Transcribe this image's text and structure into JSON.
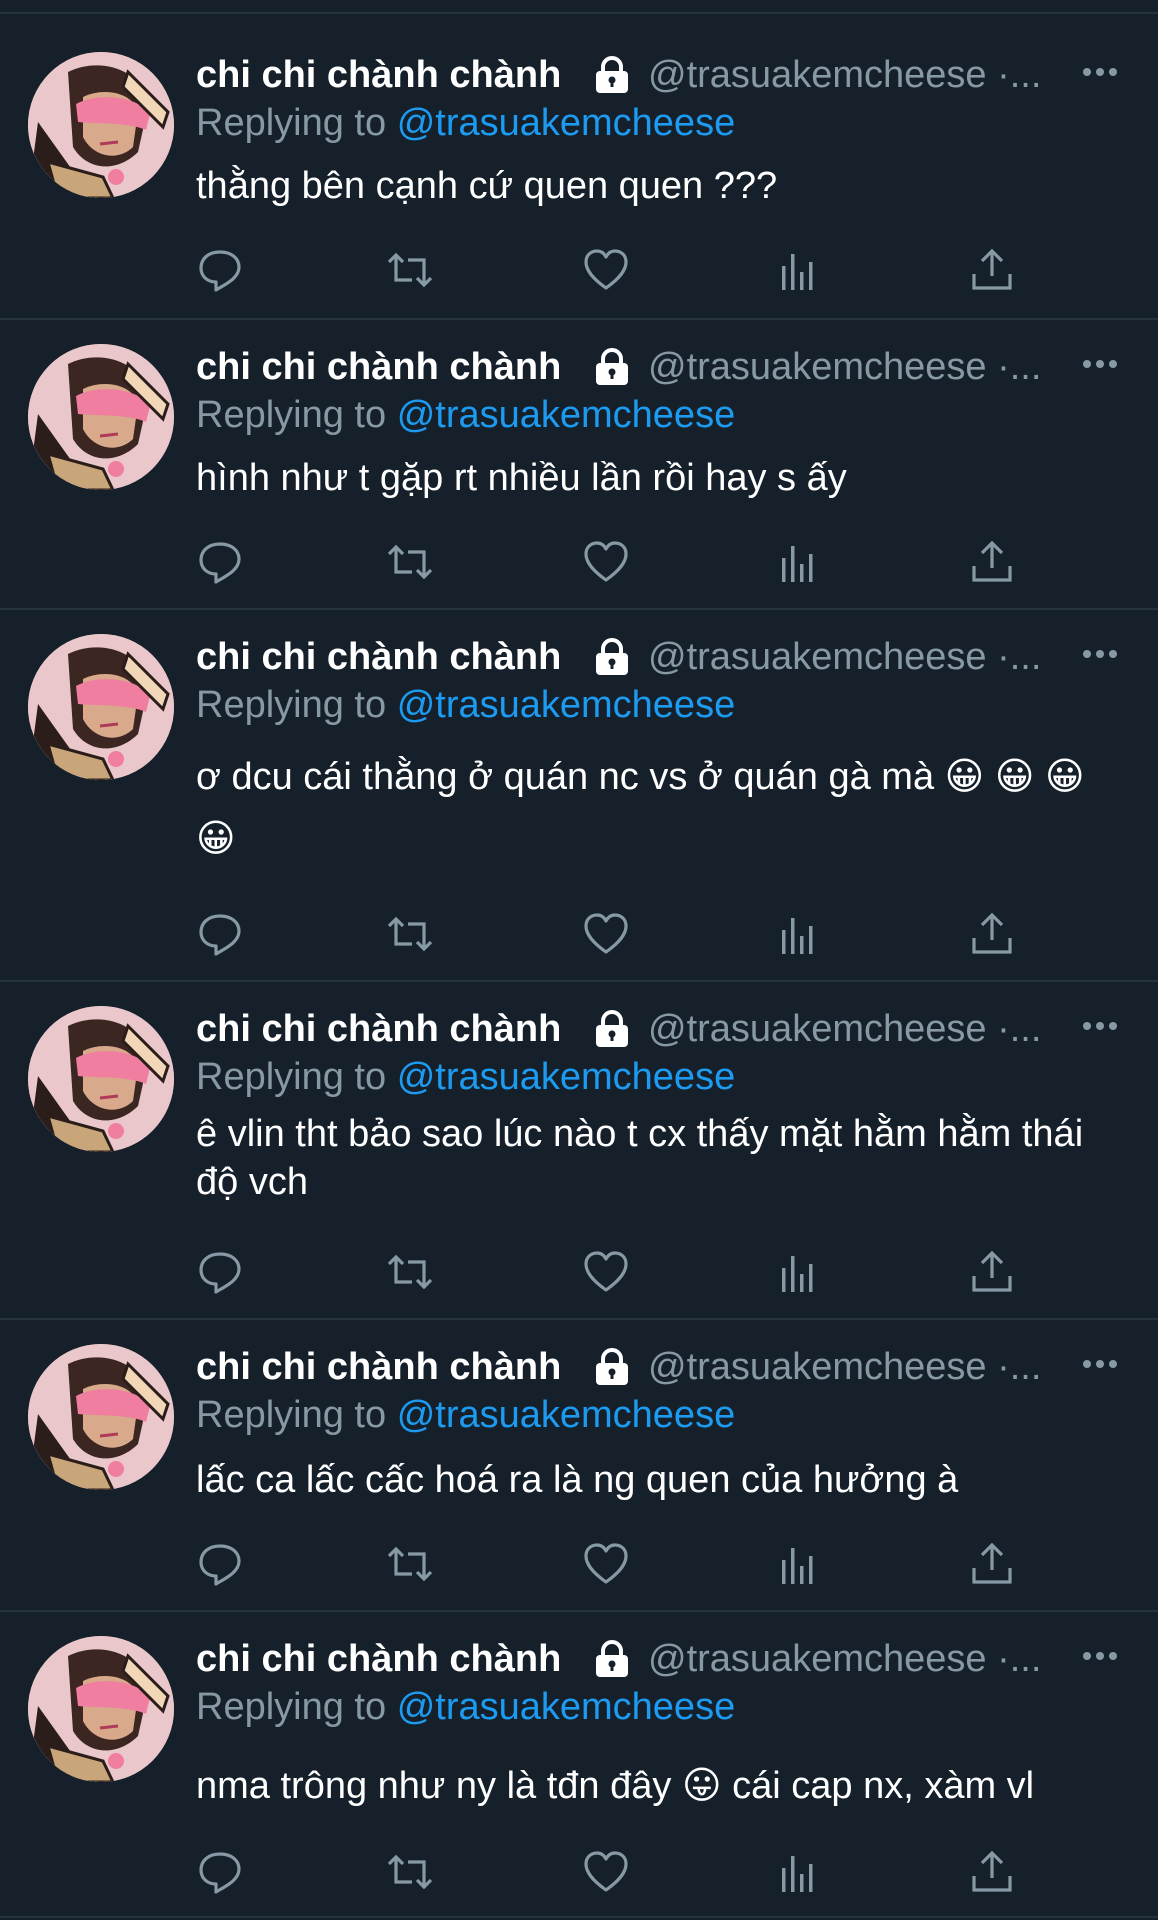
{
  "colors": {
    "background": "#15202b",
    "divider": "#253341",
    "text_primary": "#ffffff",
    "text_secondary": "#8899a6",
    "mention": "#1d9bf0"
  },
  "icons": {
    "lock": "lock-icon",
    "more": "more-icon",
    "reply": "reply-icon",
    "retweet": "retweet-icon",
    "like": "heart-icon",
    "stats": "stats-icon",
    "share": "share-icon"
  },
  "tweets": [
    {
      "display_name": "chi chi chành chành",
      "handle": "@trasuakemcheese ·...",
      "reply_prefix": "Replying to",
      "reply_to": "@trasuakemcheese",
      "text": "thằng bên cạnh cứ quen quen ???"
    },
    {
      "display_name": "chi chi chành chành",
      "handle": "@trasuakemcheese ·...",
      "reply_prefix": "Replying to",
      "reply_to": "@trasuakemcheese",
      "text": "hình như t gặp rt nhiều lần rồi hay s ấy"
    },
    {
      "display_name": "chi chi chành chành",
      "handle": "@trasuakemcheese ·...",
      "reply_prefix": "Replying to",
      "reply_to": "@trasuakemcheese",
      "text": "ơ dcu cái thằng ở quán nc vs ở quán gà mà 😀 😀 😀 😀"
    },
    {
      "display_name": "chi chi chành chành",
      "handle": "@trasuakemcheese ·...",
      "reply_prefix": "Replying to",
      "reply_to": "@trasuakemcheese",
      "text": "ê vlin tht bảo sao lúc nào t cx thấy mặt hằm hằm thái độ vch"
    },
    {
      "display_name": "chi chi chành chành",
      "handle": "@trasuakemcheese ·...",
      "reply_prefix": "Replying to",
      "reply_to": "@trasuakemcheese",
      "text": "lấc ca lấc cấc hoá ra là ng quen của hưởng à"
    },
    {
      "display_name": "chi chi chành chành",
      "handle": "@trasuakemcheese ·...",
      "reply_prefix": "Replying to",
      "reply_to": "@trasuakemcheese",
      "text": "nma trông như ny là tđn đây 😛 cái cap nx, xàm vl"
    }
  ]
}
